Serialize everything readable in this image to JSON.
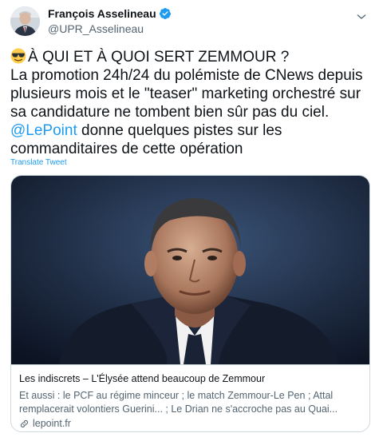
{
  "author": {
    "name": "François Asselineau",
    "handle": "@UPR_Asselineau",
    "verified_color": "#1d9bf0"
  },
  "tweet": {
    "lines": [
      "À QUI ET À QUOI SERT ZEMMOUR ?",
      "La promotion 24h/24 du polémiste de CNews depuis plusieurs mois et le \"teaser\" marketing orchestré sur sa candidature ne tombent bien sûr pas du ciel."
    ],
    "emoji": "sunglasses-emoji",
    "mention": "@LePoint",
    "mention_tail": " donne quelques pistes sur les commanditaires de cette opération",
    "mention_color": "#1d9bf0"
  },
  "translate_label": "Translate Tweet",
  "card": {
    "title": "Les indiscrets – L'Élysée attend beaucoup de Zemmour",
    "description_lines": [
      "Et aussi : le PCF au régime minceur ; le match Zemmour-Le Pen ; Attal",
      "remplacerait volontiers Guerini... ; Le Drian ne s'accroche pas au Quai..."
    ],
    "domain": "lepoint.fr"
  },
  "icons": {
    "verified": "verified-badge-icon",
    "more": "chevron-down-icon",
    "link": "link-icon"
  }
}
